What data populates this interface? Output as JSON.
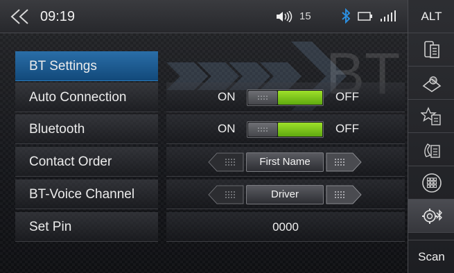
{
  "status": {
    "time": "09:19",
    "volume": "15"
  },
  "rail": {
    "top_label": "ALT",
    "bottom_label": "Scan",
    "icons": [
      "phone-book-icon",
      "internet-icon",
      "favorites-icon",
      "call-log-icon",
      "dialpad-icon",
      "bluetooth-settings-icon"
    ]
  },
  "watermark": "BT",
  "header": "BT Settings",
  "rows": [
    {
      "label": "Auto Connection",
      "on": "ON",
      "off": "OFF",
      "fill": 0.58
    },
    {
      "label": "Bluetooth",
      "on": "ON",
      "off": "OFF",
      "fill": 0.58
    },
    {
      "label": "Contact Order",
      "value": "First Name"
    },
    {
      "label": "BT-Voice Channel",
      "value": "Driver"
    },
    {
      "label": "Set Pin",
      "value": "0000"
    }
  ],
  "colors": {
    "accent_blue": "#1f5f96",
    "toggle_green": "#7cc61d",
    "bt_icon": "#2b8fe0"
  }
}
